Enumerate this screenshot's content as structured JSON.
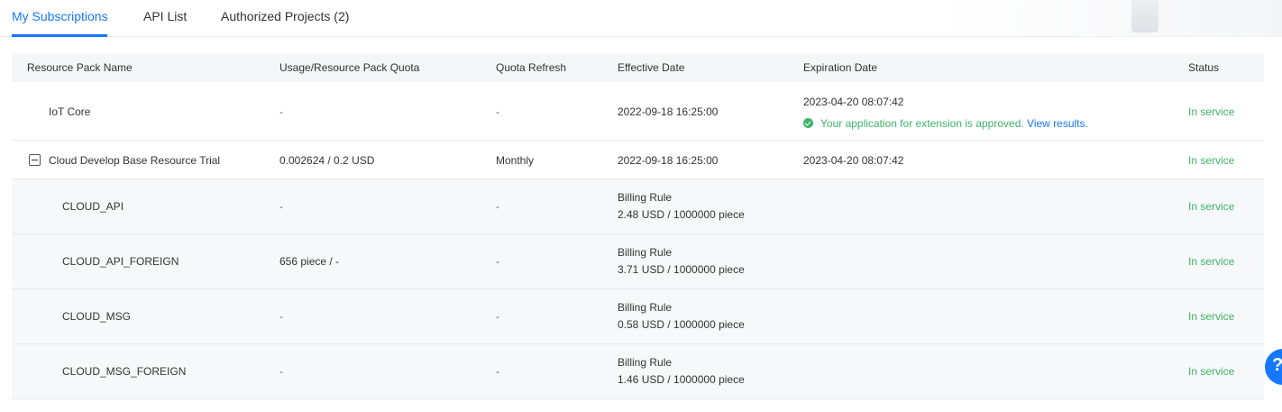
{
  "tabs": [
    {
      "label": "My Subscriptions",
      "active": true
    },
    {
      "label": "API List"
    },
    {
      "label": "Authorized Projects (2)"
    }
  ],
  "table": {
    "headers": [
      "Resource Pack Name",
      "Usage/Resource Pack Quota",
      "Quota Refresh",
      "Effective Date",
      "Expiration Date",
      "Status"
    ],
    "rows": [
      {
        "name": "IoT Core",
        "usage": "-",
        "refresh": "-",
        "effective": "2022-09-18 16:25:00",
        "expiration": "2023-04-20 08:07:42",
        "notice": "Your application for extension is approved.",
        "notice_link": "View results.",
        "status": "In service"
      },
      {
        "name": "Cloud Develop Base Resource Trial",
        "usage": "0.002624 / 0.2 USD",
        "refresh": "Monthly",
        "effective": "2022-09-18 16:25:00",
        "expiration": "2023-04-20 08:07:42",
        "status": "In service"
      }
    ],
    "child_rows": [
      {
        "name": "CLOUD_API",
        "usage": "-",
        "refresh": "-",
        "rule_label": "Billing Rule",
        "rule": "2.48 USD / 1000000 piece",
        "status": "In service"
      },
      {
        "name": "CLOUD_API_FOREIGN",
        "usage": "656 piece / -",
        "refresh": "-",
        "rule_label": "Billing Rule",
        "rule": "3.71 USD / 1000000 piece",
        "status": "In service"
      },
      {
        "name": "CLOUD_MSG",
        "usage": "-",
        "refresh": "-",
        "rule_label": "Billing Rule",
        "rule": "0.58 USD / 1000000 piece",
        "status": "In service"
      },
      {
        "name": "CLOUD_MSG_FOREIGN",
        "usage": "-",
        "refresh": "-",
        "rule_label": "Billing Rule",
        "rule": "1.46 USD / 1000000 piece",
        "status": "In service"
      }
    ]
  },
  "colors": {
    "accent": "#1677ff",
    "success": "#3eb36b",
    "header_bg": "#f5f6f7",
    "child_row_bg": "#f7f8fa"
  },
  "icons": {
    "collapse": "minus-square-icon",
    "check": "check-circle-icon",
    "help": "help-icon"
  }
}
